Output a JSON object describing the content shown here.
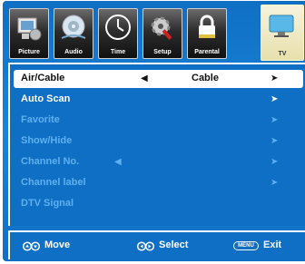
{
  "tabs": [
    {
      "label": "Picture",
      "icon": "picture-icon",
      "active": false
    },
    {
      "label": "Audio",
      "icon": "audio-icon",
      "active": false
    },
    {
      "label": "Time",
      "icon": "clock-icon",
      "active": false
    },
    {
      "label": "Setup",
      "icon": "gear-icon",
      "active": false
    },
    {
      "label": "Parental",
      "icon": "lock-icon",
      "active": false
    },
    {
      "label": "TV",
      "icon": "tv-icon",
      "active": true
    }
  ],
  "menu": {
    "items": [
      {
        "label": "Air/Cable",
        "value": "Cable",
        "left_arrow": "◀",
        "right_arrow": "➤",
        "enabled": true,
        "selected": true
      },
      {
        "label": "Auto Scan",
        "value": "",
        "left_arrow": "",
        "right_arrow": "➤",
        "enabled": true,
        "selected": false
      },
      {
        "label": "Favorite",
        "value": "",
        "left_arrow": "",
        "right_arrow": "➤",
        "enabled": false,
        "selected": false
      },
      {
        "label": "Show/Hide",
        "value": "",
        "left_arrow": "",
        "right_arrow": "➤",
        "enabled": false,
        "selected": false
      },
      {
        "label": "Channel No.",
        "value": "",
        "left_arrow": "◀",
        "right_arrow": "➤",
        "enabled": false,
        "selected": false
      },
      {
        "label": "Channel label",
        "value": "",
        "left_arrow": "",
        "right_arrow": "➤",
        "enabled": false,
        "selected": false
      },
      {
        "label": "DTV Signal",
        "value": "",
        "left_arrow": "",
        "right_arrow": "",
        "enabled": false,
        "selected": false
      }
    ]
  },
  "hints": {
    "move": {
      "icon": "updown-arrows-icon",
      "label": "Move"
    },
    "select": {
      "icon": "leftright-arrows-icon",
      "label": "Select"
    },
    "exit": {
      "icon": "menu-button-icon",
      "icon_text": "MENU",
      "label": "Exit"
    }
  },
  "colors": {
    "background": "#1a84d6",
    "panel": "#0f6fc4",
    "disabled_text": "#5fb0ef",
    "selected_row": "#ffffff"
  }
}
